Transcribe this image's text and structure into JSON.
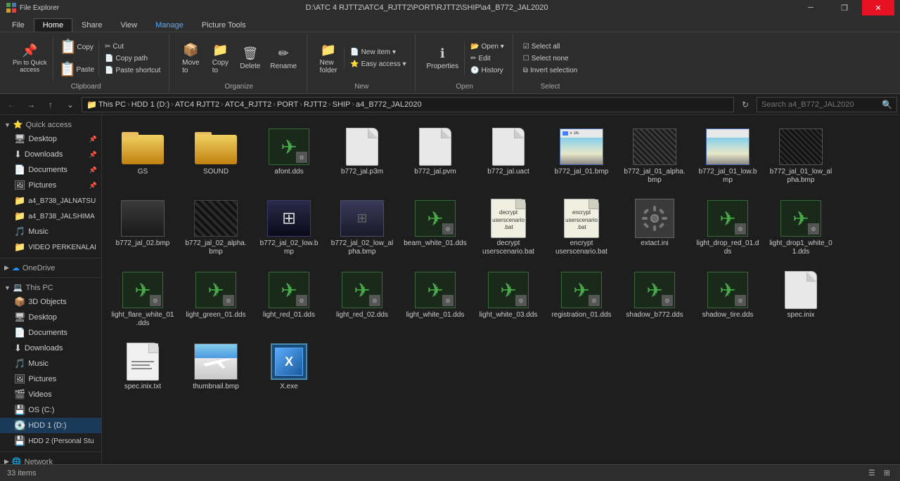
{
  "titlebar": {
    "title": "a4_B772_JAL2020",
    "path": "D:\\ATC 4 RJTT2\\ATC4_RJTT2\\PORT\\RJTT2\\SHIP\\a4_B772_JAL2020",
    "min_label": "─",
    "restore_label": "❐",
    "close_label": "✕"
  },
  "tabs": [
    {
      "label": "File",
      "active": false
    },
    {
      "label": "Home",
      "active": true
    },
    {
      "label": "Share",
      "active": false
    },
    {
      "label": "View",
      "active": false
    },
    {
      "label": "Manage",
      "active": false
    },
    {
      "label": "Picture Tools",
      "active": false
    }
  ],
  "ribbon": {
    "groups": [
      {
        "label": "Clipboard",
        "buttons": [
          {
            "label": "Pin to Quick access",
            "icon": "📌",
            "type": "large"
          },
          {
            "label": "Copy",
            "icon": "📋",
            "type": "large"
          },
          {
            "label": "Paste",
            "icon": "📋",
            "type": "large"
          }
        ],
        "small_buttons": [
          {
            "label": "Cut",
            "icon": "✂"
          },
          {
            "label": "Copy path",
            "icon": "📄"
          },
          {
            "label": "Paste shortcut",
            "icon": "📄"
          }
        ]
      },
      {
        "label": "Organize",
        "buttons": [
          {
            "label": "Move to",
            "icon": "→",
            "type": "large"
          },
          {
            "label": "Copy to",
            "icon": "⧉",
            "type": "large"
          },
          {
            "label": "Delete",
            "icon": "✕",
            "type": "large"
          },
          {
            "label": "Rename",
            "icon": "✏",
            "type": "large"
          }
        ]
      },
      {
        "label": "New",
        "buttons": [
          {
            "label": "New folder",
            "icon": "📁",
            "type": "large"
          }
        ],
        "small_buttons": [
          {
            "label": "New item ▾",
            "icon": "📄"
          }
        ]
      },
      {
        "label": "Open",
        "buttons": [
          {
            "label": "Properties",
            "icon": "ℹ",
            "type": "large"
          }
        ],
        "small_buttons": [
          {
            "label": "Open ▾",
            "icon": "📂"
          },
          {
            "label": "Edit",
            "icon": "✏"
          },
          {
            "label": "History",
            "icon": "🕐"
          }
        ]
      },
      {
        "label": "Select",
        "small_buttons": [
          {
            "label": "Select all",
            "icon": "☑"
          },
          {
            "label": "Select none",
            "icon": "☐"
          },
          {
            "label": "Invert selection",
            "icon": "⧉"
          }
        ]
      }
    ]
  },
  "breadcrumb": {
    "items": [
      "This PC",
      "HDD 1 (D:)",
      "ATC4 RJTT2",
      "ATC4_RJTT2",
      "PORT",
      "RJTT2",
      "SHIP",
      "a4_B772_JAL2020"
    ],
    "search_placeholder": "Search a4_B772_JAL2020"
  },
  "sidebar": {
    "sections": [
      {
        "label": "Quick access",
        "items": [
          {
            "label": "Desktop",
            "icon": "🖥",
            "pinned": true
          },
          {
            "label": "Downloads",
            "icon": "⬇",
            "pinned": true
          },
          {
            "label": "Documents",
            "icon": "📄",
            "pinned": true
          },
          {
            "label": "Pictures",
            "icon": "🖼",
            "pinned": true
          },
          {
            "label": "a4_B738_JALNATSU",
            "icon": "📁",
            "pinned": false
          },
          {
            "label": "a4_B738_JALSHIMA",
            "icon": "📁",
            "pinned": false
          },
          {
            "label": "Music",
            "icon": "♪",
            "pinned": false
          },
          {
            "label": "VIDEO PERKENALAI",
            "icon": "📁",
            "pinned": false
          }
        ]
      },
      {
        "label": "OneDrive",
        "items": []
      },
      {
        "label": "This PC",
        "items": [
          {
            "label": "3D Objects",
            "icon": "📦"
          },
          {
            "label": "Desktop",
            "icon": "🖥"
          },
          {
            "label": "Documents",
            "icon": "📄"
          },
          {
            "label": "Downloads",
            "icon": "⬇"
          },
          {
            "label": "Music",
            "icon": "♪"
          },
          {
            "label": "Pictures",
            "icon": "🖼"
          },
          {
            "label": "Videos",
            "icon": "🎬"
          },
          {
            "label": "OS (C:)",
            "icon": "💾"
          },
          {
            "label": "HDD 1 (D:)",
            "icon": "💾",
            "active": true
          },
          {
            "label": "HDD 2 (Personal Stu",
            "icon": "💾"
          }
        ]
      },
      {
        "label": "Network",
        "items": []
      }
    ]
  },
  "files": [
    {
      "name": "GS",
      "type": "folder"
    },
    {
      "name": "SOUND",
      "type": "folder"
    },
    {
      "name": "afont.dds",
      "type": "dds"
    },
    {
      "name": "b772_jal.p3m",
      "type": "generic"
    },
    {
      "name": "b772_jal.pvm",
      "type": "generic"
    },
    {
      "name": "b772_jal.uact",
      "type": "generic"
    },
    {
      "name": "b772_jal_01.bmp",
      "type": "screenshot"
    },
    {
      "name": "b772_jal_01_alpha.bmp",
      "type": "screenshot"
    },
    {
      "name": "b772_jal_01_low.bmp",
      "type": "screenshot"
    },
    {
      "name": "b772_jal_01_low_alpha.bmp",
      "type": "screenshot"
    },
    {
      "name": "b772_jal_02.bmp",
      "type": "screenshot"
    },
    {
      "name": "b772_jal_02_alpha.bmp",
      "type": "screenshot"
    },
    {
      "name": "b772_jal_02_low.bmp",
      "type": "screenshot_dark"
    },
    {
      "name": "b772_jal_02_low_alpha.bmp",
      "type": "screenshot_dark2"
    },
    {
      "name": "beam_white_01.dds",
      "type": "plane"
    },
    {
      "name": "decrypt userscenario.bat",
      "type": "bat"
    },
    {
      "name": "encrypt userscenario.bat",
      "type": "bat"
    },
    {
      "name": "extact.ini",
      "type": "gear"
    },
    {
      "name": "light_drop_red_01.dds",
      "type": "plane"
    },
    {
      "name": "light_drop1_white_01.dds",
      "type": "plane"
    },
    {
      "name": "light_flare_white_01.dds",
      "type": "plane"
    },
    {
      "name": "light_green_01.dds",
      "type": "plane"
    },
    {
      "name": "light_red_01.dds",
      "type": "plane"
    },
    {
      "name": "light_red_02.dds",
      "type": "plane"
    },
    {
      "name": "light_white_01.dds",
      "type": "plane"
    },
    {
      "name": "light_white_03.dds",
      "type": "plane"
    },
    {
      "name": "registration_01.dds",
      "type": "plane"
    },
    {
      "name": "shadow_b772.dds",
      "type": "plane"
    },
    {
      "name": "shadow_tire.dds",
      "type": "plane"
    },
    {
      "name": "spec.inix",
      "type": "generic_white"
    },
    {
      "name": "spec.inix.txt",
      "type": "txt"
    },
    {
      "name": "thumbnail.bmp",
      "type": "thumbnail"
    },
    {
      "name": "X.exe",
      "type": "exe"
    }
  ],
  "status": {
    "item_count": "33 items"
  }
}
